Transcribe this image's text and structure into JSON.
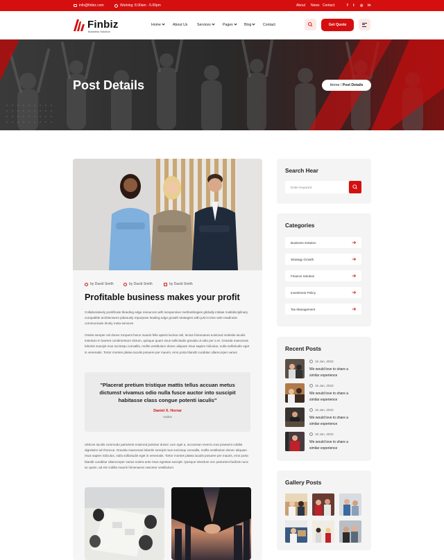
{
  "topbar": {
    "email": "info@finbiz.com",
    "hours": "Working: 8.00am - 5.00pm",
    "links": [
      "About",
      "News",
      "Contact"
    ],
    "social_icons": [
      "facebook-icon",
      "twitter-icon",
      "instagram-icon",
      "linkedin-icon"
    ],
    "social_glyphs": [
      "f",
      "t",
      "◎",
      "in"
    ]
  },
  "header": {
    "logo_name": "Finbiz",
    "logo_tagline": "Business Solution",
    "nav": [
      "Home",
      "About Us",
      "Services",
      "Pages",
      "Blog",
      "Contact"
    ],
    "quote_button": "Get Quote"
  },
  "hero": {
    "title": "Post Details",
    "breadcrumb_home": "Home",
    "breadcrumb_sep": " / ",
    "breadcrumb_current": "Post Details"
  },
  "post": {
    "meta": [
      "by David Smith",
      "by David Smith",
      "by David Smith"
    ],
    "title": "Profitable business makes your profit",
    "para1": "Collaboratively pontificate bleeding edge resources with inexpensive methodologies globally initiate multidisciplinary compatible architectures pideously repurpose leading edge growth strategies with just in time web readiness communicate timely meta services",
    "para2": "Onsite semper vel donec torquent fusce mauris felis aptent lacinia nisl, lectus himenaeos euismod molestie iaculis interdum in laoreet condimentum dictum, quisque quam risus sollicitudin gravida ut odio per a et. Gravida maecenas lobortis suscipit mus sociosqu convallis, mollis vestibulum donec aliquam risus sapien ridiculus, nulla sollicitudin eget in venenatis. Tortor montes platea iaculis posuere per mauris, eros porta blandit curabitur ullamcorper varius",
    "quote": "\"Placerat pretium tristique mattis tellus accuan metus dictumst vivamus odio nulla fusce auctor into suscipit habitasse class congue potenti iaculis\"",
    "quote_author": "Daniel X. Horrar",
    "quote_role": "Author",
    "para3": "Ultrices iaculis commodo parturient euismod pulvinar donec cum eget a, accumsan viverra cras praesent cubilia dignissim ad rhoncus. Gravida maecenas lobortis suscipit mus sociosqu convallis, mollis vestibulum donec aliquam risus sapien ridiculus, nulla sollicitudin eget in venenatis. Tortor montes platea iaculis posuere per mauris, eros porta blandit curabitur ullamcorper varius nostra ante risus egestas suscipit. Quisque interdum nec parturient facilisis nunc ac quam, ad est cubilia mauris himenaeos nascetur vestibulum."
  },
  "sidebar": {
    "search_title": "Search Hear",
    "search_placeholder": "Enter Keyword",
    "categories_title": "Categories",
    "categories": [
      "Business Solution",
      "Strategy Growth",
      "Finance Solution",
      "Investment Policy",
      "Tax Management"
    ],
    "recent_title": "Recent Posts",
    "recent": [
      {
        "date": "15 Jan, 2023",
        "title": "We would love to share a similar experience"
      },
      {
        "date": "15 Jan, 2023",
        "title": "We would love to share a similar experience"
      },
      {
        "date": "15 Jan, 2023",
        "title": "We would love to share a similar experience"
      },
      {
        "date": "15 Jan, 2023",
        "title": "We would love to share a similar experience"
      }
    ],
    "gallery_title": "Gallery Posts"
  },
  "colors": {
    "brand_red": "#d50f0f",
    "card_bg": "#f4f4f4",
    "light_pink": "#fde8e8"
  }
}
